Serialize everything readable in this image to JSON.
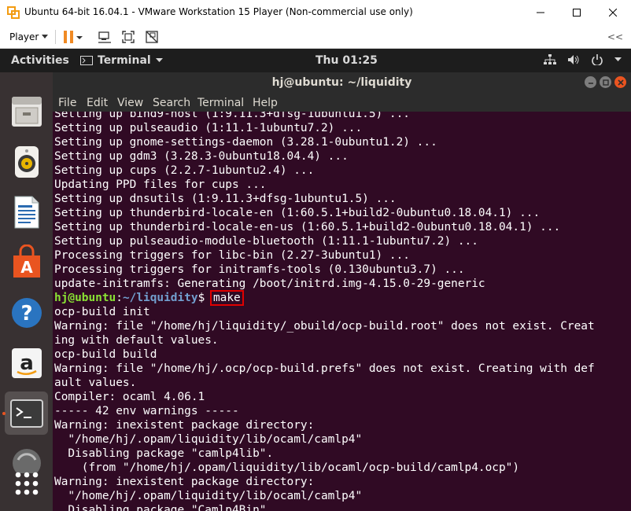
{
  "window": {
    "title": "Ubuntu 64-bit 16.04.1 - VMware Workstation 15 Player (Non-commercial use only)"
  },
  "toolbar": {
    "player_label": "Player"
  },
  "topbar": {
    "activities": "Activities",
    "app_menu": "Terminal",
    "clock": "Thu 01:25"
  },
  "dock": {
    "items": [
      "files-icon",
      "rhythmbox-icon",
      "libreoffice-writer-icon",
      "software-center-icon",
      "help-icon",
      "amazon-icon",
      "terminal-icon",
      "software-updater-icon",
      "show-applications-icon"
    ]
  },
  "terminal": {
    "title": "hj@ubuntu: ~/liquidity",
    "menu": [
      "File",
      "Edit",
      "View",
      "Search",
      "Terminal",
      "Help"
    ],
    "lines_before": [
      "Setting up bind9-host (1:9.11.3+dfsg-1ubuntu1.5) ...",
      "Setting up pulseaudio (1:11.1-1ubuntu7.2) ...",
      "Setting up gnome-settings-daemon (3.28.1-0ubuntu1.2) ...",
      "Setting up gdm3 (3.28.3-0ubuntu18.04.4) ...",
      "Setting up cups (2.2.7-1ubuntu2.4) ...",
      "Updating PPD files for cups ...",
      "Setting up dnsutils (1:9.11.3+dfsg-1ubuntu1.5) ...",
      "Setting up thunderbird-locale-en (1:60.5.1+build2-0ubuntu0.18.04.1) ...",
      "Setting up thunderbird-locale-en-us (1:60.5.1+build2-0ubuntu0.18.04.1) ...",
      "Setting up pulseaudio-module-bluetooth (1:11.1-1ubuntu7.2) ...",
      "Processing triggers for libc-bin (2.27-3ubuntu1) ...",
      "Processing triggers for initramfs-tools (0.130ubuntu3.7) ...",
      "update-initramfs: Generating /boot/initrd.img-4.15.0-29-generic"
    ],
    "prompt_user": "hj@ubuntu",
    "prompt_sep": ":",
    "prompt_path": "~/liquidity",
    "prompt_dollar": "$ ",
    "command": "make",
    "lines_after": [
      "ocp-build init",
      "Warning: file \"/home/hj/liquidity/_obuild/ocp-build.root\" does not exist. Creat",
      "ing with default values.",
      "ocp-build build",
      "Warning: file \"/home/hj/.ocp/ocp-build.prefs\" does not exist. Creating with def",
      "ault values.",
      "Compiler: ocaml 4.06.1",
      "----- 42 env warnings -----",
      "Warning: inexistent package directory:",
      "  \"/home/hj/.opam/liquidity/lib/ocaml/camlp4\"",
      "  Disabling package \"camlp4lib\".",
      "    (from \"/home/hj/.opam/liquidity/lib/ocaml/ocp-build/camlp4.ocp\")",
      "Warning: inexistent package directory:",
      "  \"/home/hj/.opam/liquidity/lib/ocaml/camlp4\"",
      "  Disabling package \"Camlp4Bin\"."
    ]
  }
}
